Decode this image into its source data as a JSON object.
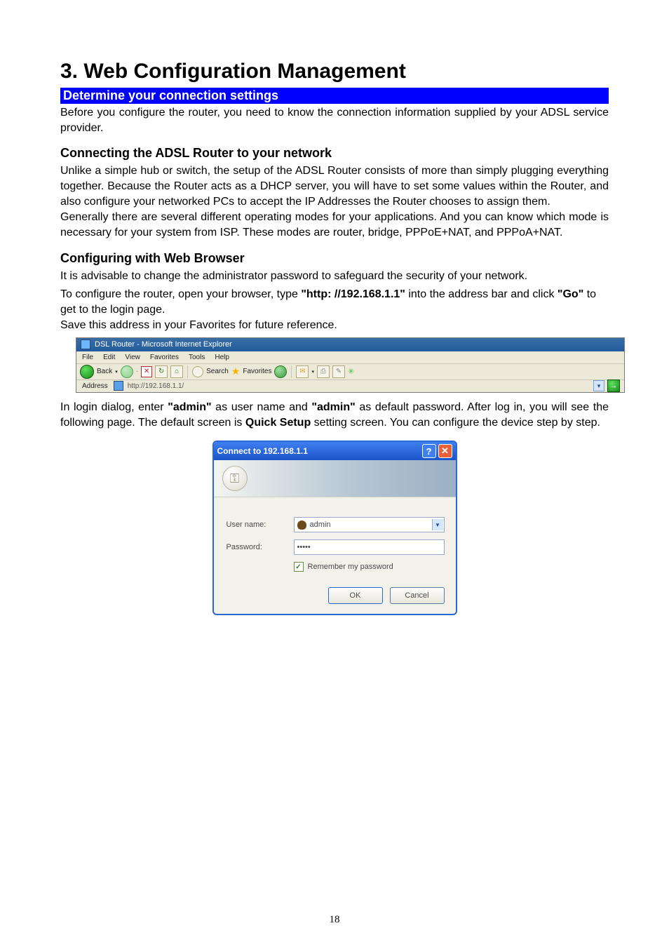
{
  "title": "3. Web Configuration Management",
  "section_bar": "Determine your connection settings",
  "intro": "Before you configure the router, you need to know the connection information supplied by your ADSL service provider.",
  "h2_connect": "Connecting the ADSL Router to your network",
  "connect_p1": "Unlike a simple hub or switch, the setup of the ADSL Router consists of more than simply plugging everything together. Because the Router acts as a DHCP server, you will have to set some values within the Router, and also configure your networked PCs to accept the IP Addresses the Router chooses to assign them.",
  "connect_p2": "Generally there are several different operating modes for your applications. And you can know which mode is necessary for your system from ISP. These modes are router, bridge, PPPoE+NAT, and PPPoA+NAT.",
  "h2_browser": "Configuring with Web Browser",
  "browser_p1": "It is advisable to change the administrator password to safeguard the security of your network.",
  "browser_p2_a": "To configure the router, open your browser, type ",
  "browser_p2_b": "\"http: //192.168.1.1\"",
  "browser_p2_c": " into the address bar and click ",
  "browser_p2_d": "\"Go\"",
  "browser_p2_e": " to get to the login page.",
  "browser_p3": "Save this address in your Favorites for future reference.",
  "login_p_a": "In login dialog, enter ",
  "login_p_b": "\"admin\"",
  "login_p_c": " as user name and ",
  "login_p_d": "\"admin\"",
  "login_p_e": " as default password. After log in, you will see the following page. The default screen is ",
  "login_p_f": "Quick Setup",
  "login_p_g": " setting screen. You can configure the device step by step.",
  "ie": {
    "title": "DSL Router - Microsoft Internet Explorer",
    "menu": [
      "File",
      "Edit",
      "View",
      "Favorites",
      "Tools",
      "Help"
    ],
    "back": "Back",
    "search": "Search",
    "favorites": "Favorites",
    "address_label": "Address",
    "url": "http://192.168.1.1/"
  },
  "dlg": {
    "title": "Connect to 192.168.1.1",
    "user_label": "User name:",
    "pass_label": "Password:",
    "user_value": "admin",
    "pass_value": "•••••",
    "remember": "Remember my password",
    "ok": "OK",
    "cancel": "Cancel"
  },
  "page_number": "18"
}
